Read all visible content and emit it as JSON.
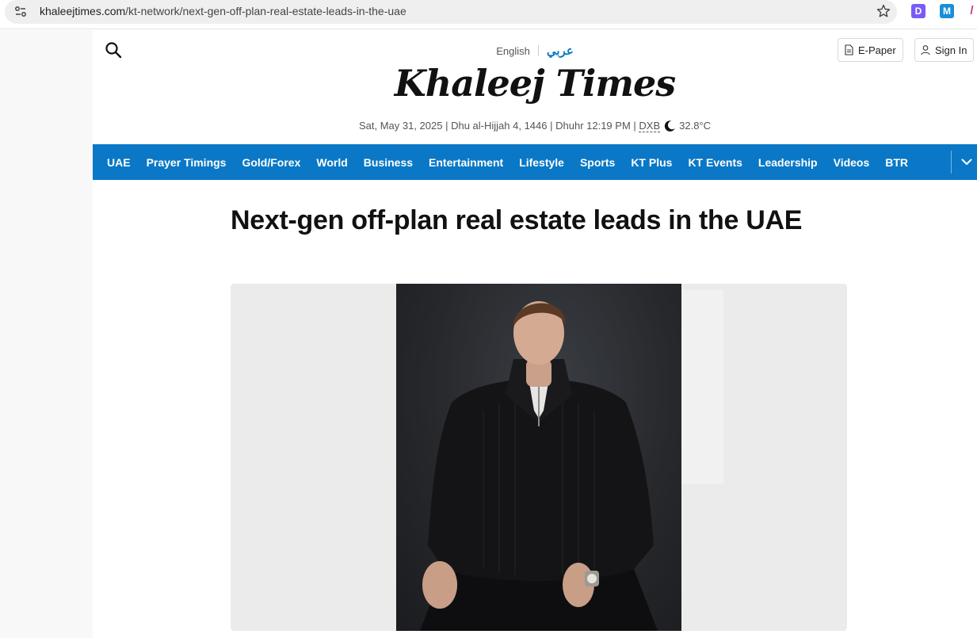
{
  "browser": {
    "url_host": "khaleejtimes.com",
    "url_path": "/kt-network/next-gen-off-plan-real-estate-leads-in-the-uae",
    "extensions": [
      "D",
      "M",
      "/"
    ]
  },
  "masthead": {
    "lang_en": "English",
    "lang_ar": "عربي",
    "logo": "Khaleej Times",
    "date": "Sat, May 31, 2025",
    "hijri": "Dhu al-Hijjah 4, 1446",
    "prayer": "Dhuhr 12:19 PM",
    "city": "DXB",
    "temperature": "32.8°C",
    "epaper_label": "E-Paper",
    "signin_label": "Sign In"
  },
  "nav": {
    "items": [
      "UAE",
      "Prayer Timings",
      "Gold/Forex",
      "World",
      "Business",
      "Entertainment",
      "Lifestyle",
      "Sports",
      "KT Plus",
      "KT Events",
      "Leadership",
      "Videos",
      "BTR"
    ]
  },
  "article": {
    "headline": "Next-gen off-plan real estate leads in the UAE"
  },
  "colors": {
    "nav_bg": "#0a78c6",
    "arabic_link": "#0a7ac0"
  }
}
